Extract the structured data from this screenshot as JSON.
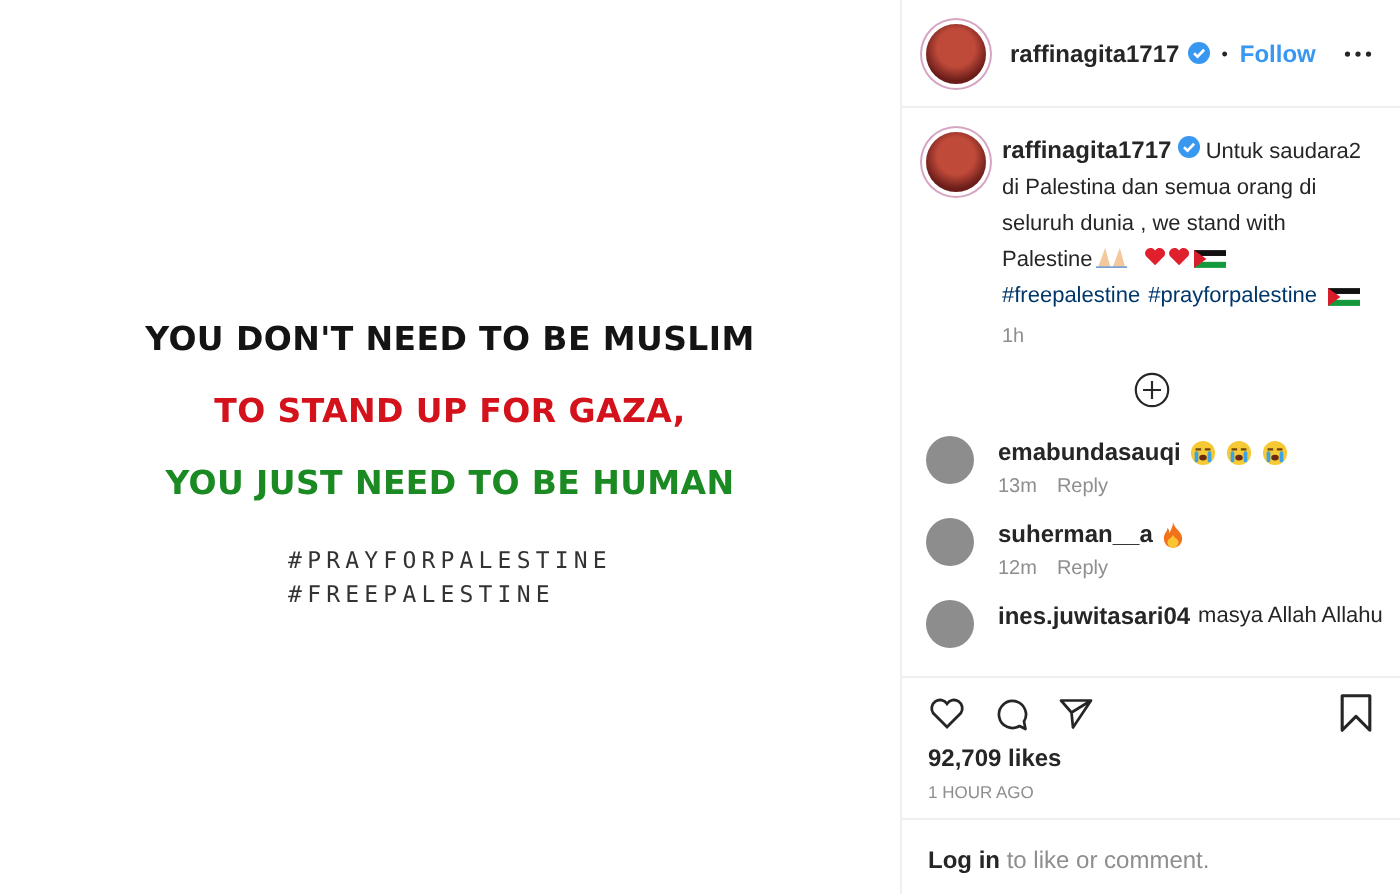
{
  "post_image": {
    "lines": [
      {
        "text": "YOU DON'T NEED TO BE MUSLIM",
        "color": "#141414"
      },
      {
        "text": "TO STAND UP FOR GAZA,",
        "color": "#d3121c"
      },
      {
        "text": "YOU JUST NEED TO BE HUMAN",
        "color": "#1b8a22"
      }
    ],
    "hashtags": [
      "#PRAYFORPALESTINE",
      "#FREEPALESTINE"
    ]
  },
  "header": {
    "username": "raffinagita1717",
    "verified": true,
    "separator": "•",
    "follow": "Follow"
  },
  "caption": {
    "username": "raffinagita1717",
    "verified": true,
    "text": "Untuk saudara2 di Palestina dan semua orang di seluruh dunia , we stand with Palestine",
    "hashtags": [
      "#freepalestine",
      "#prayforpalestine"
    ],
    "time": "1h"
  },
  "comments": [
    {
      "username": "emabundasauqi",
      "time": "13m",
      "reply": "Reply"
    },
    {
      "username": "suherman__a",
      "time": "12m",
      "reply": "Reply"
    },
    {
      "username": "ines.juwitasari04",
      "text": "masya Allah Allahu"
    }
  ],
  "likes": "92,709 likes",
  "posted": "1 HOUR AGO",
  "login": {
    "link": "Log in",
    "text": "to like or comment."
  }
}
